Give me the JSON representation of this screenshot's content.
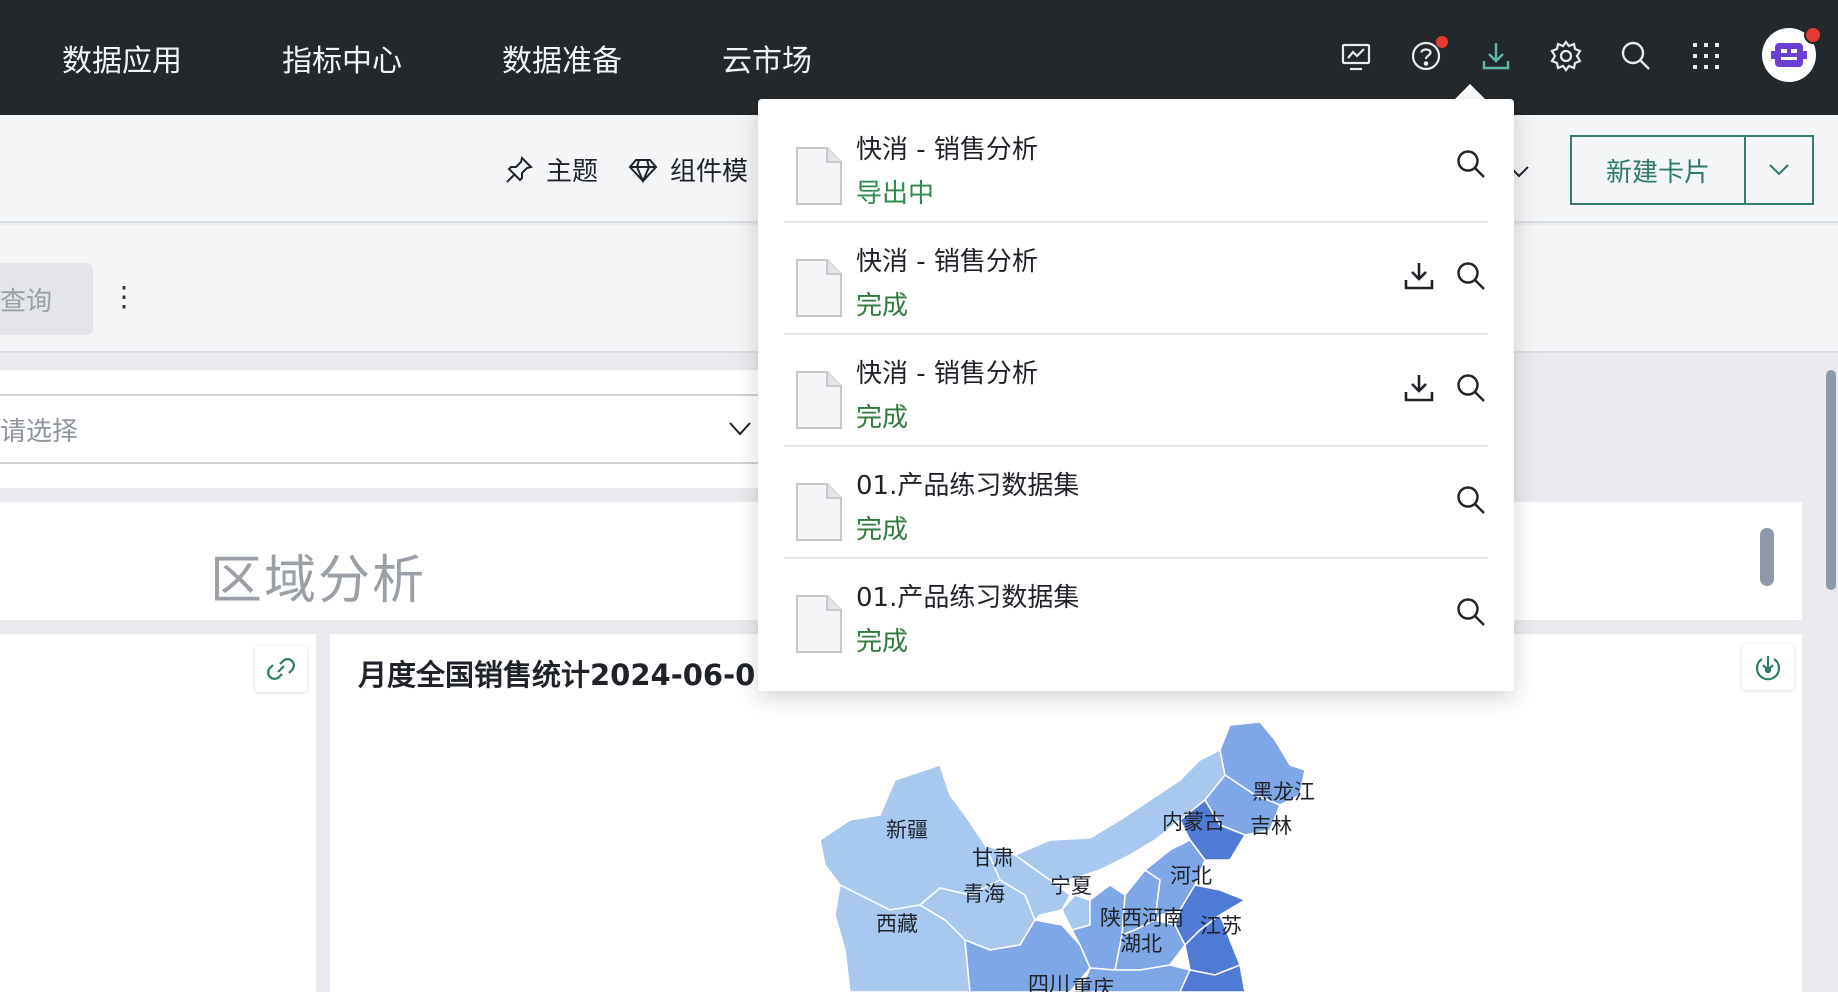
{
  "nav": {
    "items": [
      "数据应用",
      "指标中心",
      "数据准备",
      "云市场"
    ],
    "icons": [
      "monitor-icon",
      "help-icon",
      "download-icon",
      "settings-icon",
      "search-icon",
      "apps-grid-icon"
    ]
  },
  "toolbar": {
    "theme_label": "主题",
    "component_label": "组件模",
    "new_card_label": "新建卡片"
  },
  "filter": {
    "query_label": "查询",
    "more_label": "⋮",
    "select_placeholder": "请选择"
  },
  "section": {
    "title": "区域分析"
  },
  "chart": {
    "title": "月度全国销售统计2024-06-0"
  },
  "chart_data": {
    "type": "map",
    "title": "月度全国销售统计2024-06-0",
    "regions": [
      "黑龙江",
      "吉林",
      "内蒙古",
      "新疆",
      "甘肃",
      "宁夏",
      "河北",
      "青海",
      "陕西",
      "河南",
      "江苏",
      "西藏",
      "湖北",
      "四川",
      "重庆"
    ]
  },
  "downloads": {
    "items": [
      {
        "name": "快消 - 销售分析",
        "status": "导出中",
        "downloadable": false
      },
      {
        "name": "快消 - 销售分析",
        "status": "完成",
        "downloadable": true
      },
      {
        "name": "快消 - 销售分析",
        "status": "完成",
        "downloadable": true
      },
      {
        "name": "01.产品练习数据集",
        "status": "完成",
        "downloadable": false
      },
      {
        "name": "01.产品练习数据集",
        "status": "完成",
        "downloadable": false
      }
    ]
  },
  "colors": {
    "nav_bg": "#23282d",
    "accent_green": "#2f7a68",
    "status_green": "#2f7a3c",
    "map_light": "#a8c8f0",
    "map_mid": "#7fa6e6",
    "map_dark": "#4f7bd6"
  }
}
